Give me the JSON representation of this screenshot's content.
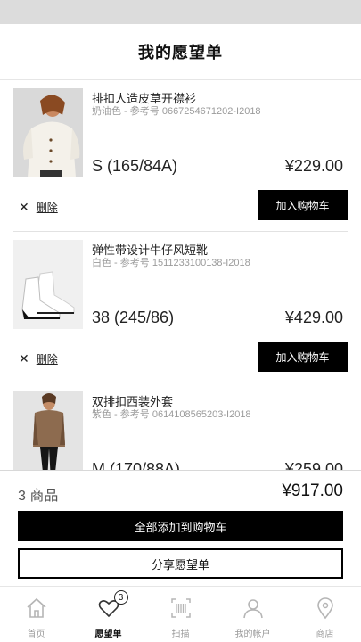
{
  "header": {
    "title": "我的愿望单"
  },
  "items": [
    {
      "name": "排扣人造皮草开襟衫",
      "meta": "奶油色 - 参考号 0667254671202-I2018",
      "size": "S (165/84A)",
      "price": "¥229.00",
      "remove_label": "删除",
      "add_to_cart_label": "加入购物车",
      "image_icon": "cardigan-photo"
    },
    {
      "name": "弹性带设计牛仔风短靴",
      "meta": "白色 - 参考号 1511233100138-I2018",
      "size": "38 (245/86)",
      "price": "¥429.00",
      "remove_label": "删除",
      "add_to_cart_label": "加入购物车",
      "image_icon": "boots-photo"
    },
    {
      "name": "双排扣西装外套",
      "meta": "紫色 - 参考号 0614108565203-I2018",
      "size": "M (170/88A)",
      "price": "¥259.00",
      "image_icon": "blazer-photo"
    }
  ],
  "summary": {
    "count": "3 商品",
    "total": "¥917.00",
    "add_all_label": "全部添加到购物车",
    "share_label": "分享愿望单"
  },
  "tabs": [
    {
      "label": "首页",
      "icon": "home-icon",
      "active": false
    },
    {
      "label": "愿望单",
      "icon": "heart-icon",
      "active": true,
      "badge": "3"
    },
    {
      "label": "扫描",
      "icon": "barcode-icon",
      "active": false
    },
    {
      "label": "我的帐户",
      "icon": "user-icon",
      "active": false
    },
    {
      "label": "商店",
      "icon": "location-pin-icon",
      "active": false
    }
  ],
  "colors": {
    "accent": "#000000",
    "muted": "#9b9b9b",
    "status_bar": "#dcdcdc"
  }
}
